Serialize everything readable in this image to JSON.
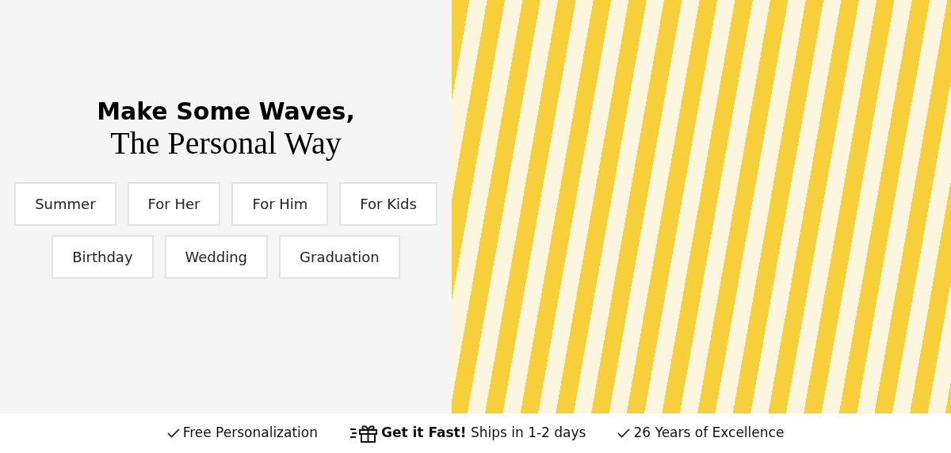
{
  "hero": {
    "headline": "Make Some Waves,",
    "subheadline": "The Personal Way",
    "categories": [
      {
        "label": "Summer"
      },
      {
        "label": "For Her"
      },
      {
        "label": "For Him"
      },
      {
        "label": "For Kids"
      },
      {
        "label": "Birthday"
      },
      {
        "label": "Wedding"
      },
      {
        "label": "Graduation"
      }
    ]
  },
  "benefits": [
    {
      "kind": "check",
      "text": "Free Personalization"
    },
    {
      "kind": "gift",
      "text": "**Get it Fast!** Ships in 1-2 days"
    },
    {
      "kind": "check",
      "text": "26 Years of Excellence"
    }
  ]
}
